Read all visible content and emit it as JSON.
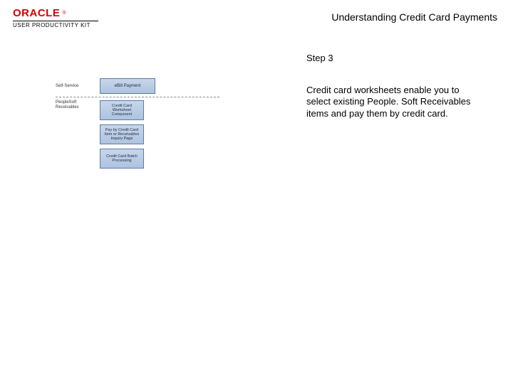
{
  "header": {
    "brand_word": "ORACLE",
    "brand_tm": "®",
    "product_line": "USER PRODUCTIVITY KIT",
    "page_title": "Understanding Credit Card Payments"
  },
  "diagram": {
    "side_label_1": "Self-Service",
    "box_ebill": "eBill Payment",
    "side_label_2": "PeopleSoft Receivables",
    "box_cc_worksheet": "Credit Card Worksheet Component",
    "box_pay_by_cc": "Pay by Credit Card Item or Receivables Inquiry Page",
    "box_batch": "Credit Card Batch Processing"
  },
  "step": {
    "label": "Step 3",
    "body": "Credit card worksheets enable you to select existing People. Soft Receivables items and pay them by credit card."
  }
}
